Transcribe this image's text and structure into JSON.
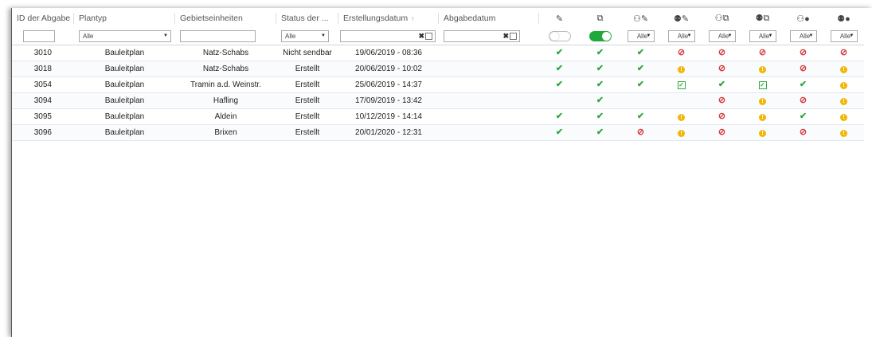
{
  "columns": [
    {
      "key": "id",
      "label": "ID der Abgabe"
    },
    {
      "key": "plantyp",
      "label": "Plantyp"
    },
    {
      "key": "gebiet",
      "label": "Gebietseinheiten"
    },
    {
      "key": "status",
      "label": "Status der ..."
    },
    {
      "key": "erstellung",
      "label": "Erstellungsdatum",
      "sort": "↑"
    },
    {
      "key": "abgabe",
      "label": "Abgabedatum"
    }
  ],
  "icon_columns": [
    {
      "name": "edit-icon",
      "glyph": "✎"
    },
    {
      "name": "copy-icon",
      "glyph": "⧉"
    },
    {
      "name": "user-edit-icon",
      "glyph": "⚇✎"
    },
    {
      "name": "group-edit-icon",
      "glyph": "⚉✎"
    },
    {
      "name": "user-copy-icon",
      "glyph": "⚇⧉"
    },
    {
      "name": "group-copy-icon",
      "glyph": "⚉⧉"
    },
    {
      "name": "user-circle-icon",
      "glyph": "⚇●"
    },
    {
      "name": "group-circle-icon",
      "glyph": "⚉●"
    }
  ],
  "filters": {
    "plantyp": "Alle",
    "status": "Alle",
    "icon_selects": [
      "Alle",
      "Alle",
      "Alle",
      "Alle",
      "Alle",
      "Alle"
    ],
    "toggle1": "off",
    "toggle2": "on"
  },
  "rows": [
    {
      "id": "3010",
      "plantyp": "Bauleitplan",
      "gebiet": "Natz-Schabs",
      "status": "Nicht sendbar",
      "erstellung": "19/06/2019 - 08:36",
      "abgabe": "",
      "icons": [
        "check",
        "check",
        "check",
        "block",
        "block",
        "block",
        "block",
        "block"
      ]
    },
    {
      "id": "3018",
      "plantyp": "Bauleitplan",
      "gebiet": "Natz-Schabs",
      "status": "Erstellt",
      "erstellung": "20/06/2019 - 10:02",
      "abgabe": "",
      "icons": [
        "check",
        "check",
        "check",
        "warn",
        "block",
        "warn",
        "block",
        "warn"
      ]
    },
    {
      "id": "3054",
      "plantyp": "Bauleitplan",
      "gebiet": "Tramin a.d. Weinstr.",
      "status": "Erstellt",
      "erstellung": "25/06/2019 - 14:37",
      "abgabe": "",
      "icons": [
        "check",
        "check",
        "check",
        "box",
        "check",
        "box",
        "check",
        "warn"
      ]
    },
    {
      "id": "3094",
      "plantyp": "Bauleitplan",
      "gebiet": "Hafling",
      "status": "Erstellt",
      "erstellung": "17/09/2019 - 13:42",
      "abgabe": "",
      "icons": [
        "",
        "check",
        "",
        "",
        "block",
        "warn",
        "block",
        "warn"
      ]
    },
    {
      "id": "3095",
      "plantyp": "Bauleitplan",
      "gebiet": "Aldein",
      "status": "Erstellt",
      "erstellung": "10/12/2019 - 14:14",
      "abgabe": "",
      "icons": [
        "check",
        "check",
        "check",
        "warn",
        "block",
        "warn",
        "check",
        "warn"
      ]
    },
    {
      "id": "3096",
      "plantyp": "Bauleitplan",
      "gebiet": "Brixen",
      "status": "Erstellt",
      "erstellung": "20/01/2020 - 12:31",
      "abgabe": "",
      "icons": [
        "check",
        "check",
        "block",
        "warn",
        "block",
        "warn",
        "block",
        "warn"
      ]
    }
  ]
}
